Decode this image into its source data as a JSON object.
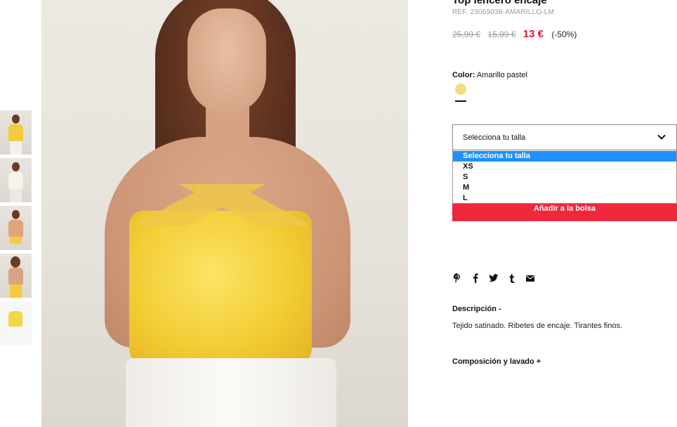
{
  "product": {
    "title": "Top lencero encaje",
    "ref": "REF. 23069038-AMARILLO-LM",
    "price_original": "25,99 €",
    "price_previous": "15,99 €",
    "price_current": "13 €",
    "discount": "(-50%)"
  },
  "color": {
    "label": "Color:",
    "value": "Amarillo pastel",
    "swatch_hex": "#f2de7c"
  },
  "size_select": {
    "placeholder": "Selecciona tu talla",
    "options": [
      "Selecciona tu talla",
      "XS",
      "S",
      "M",
      "L"
    ],
    "selected_index": 0
  },
  "actions": {
    "add_to_bag": "Añadir a la bolsa"
  },
  "share": [
    "pinterest-icon",
    "facebook-icon",
    "twitter-icon",
    "tumblr-icon",
    "email-icon"
  ],
  "description": {
    "title": "Descripción -",
    "text": "Tejido satinado. Ribetes de encaje. Tirantes finos."
  },
  "composition": {
    "title": "Composición y lavado +"
  },
  "colors": {
    "accent_red": "#f0283c",
    "price_red": "#e0162b",
    "selected_blue": "#1e90ff"
  }
}
